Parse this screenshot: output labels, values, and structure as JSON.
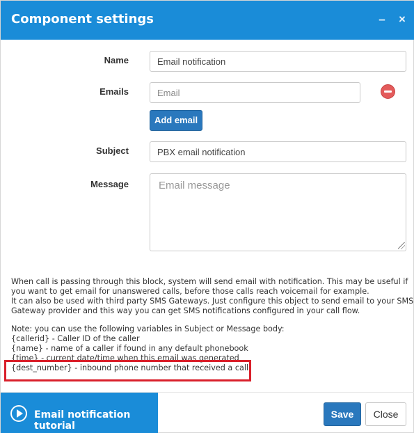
{
  "dialog": {
    "title": "Component settings",
    "minimize_symbol": "–",
    "close_symbol": "×"
  },
  "form": {
    "name_label": "Name",
    "name_value": "Email notification",
    "emails_label": "Emails",
    "email_placeholder": "Email",
    "add_email_label": "Add email",
    "subject_label": "Subject",
    "subject_value": "PBX email notification",
    "message_label": "Message",
    "message_placeholder": "Email message"
  },
  "description": {
    "lines": [
      "When call is passing through this block, system will send email with notification. This may be useful if",
      "you want to get email for unanswered calls, before those calls reach voicemail for example.",
      "It can also be used with third party SMS Gateways. Just configure this object to send email to your SMS",
      "Gateway provider and this way you can get SMS notifications configured in your call flow."
    ],
    "note_lines": [
      "Note: you can use the following variables in Subject or Message body:",
      "{callerid} - Caller ID of the caller",
      "{name} - name of a caller if found in any default phonebook",
      "{time} - current date/time when this email was generated",
      "{dest_number} - inbound phone number that received a call"
    ]
  },
  "footer": {
    "tutorial_label": "Email notification tutorial",
    "save_label": "Save",
    "close_label": "Close"
  },
  "colors": {
    "header": "#1a8cd8",
    "primary_button": "#2a78bd",
    "highlight_border": "#d9202b",
    "remove_button": "#e35b5b"
  },
  "icons": {
    "remove": "minus-circle-icon",
    "tutorial": "play-circle-icon"
  }
}
